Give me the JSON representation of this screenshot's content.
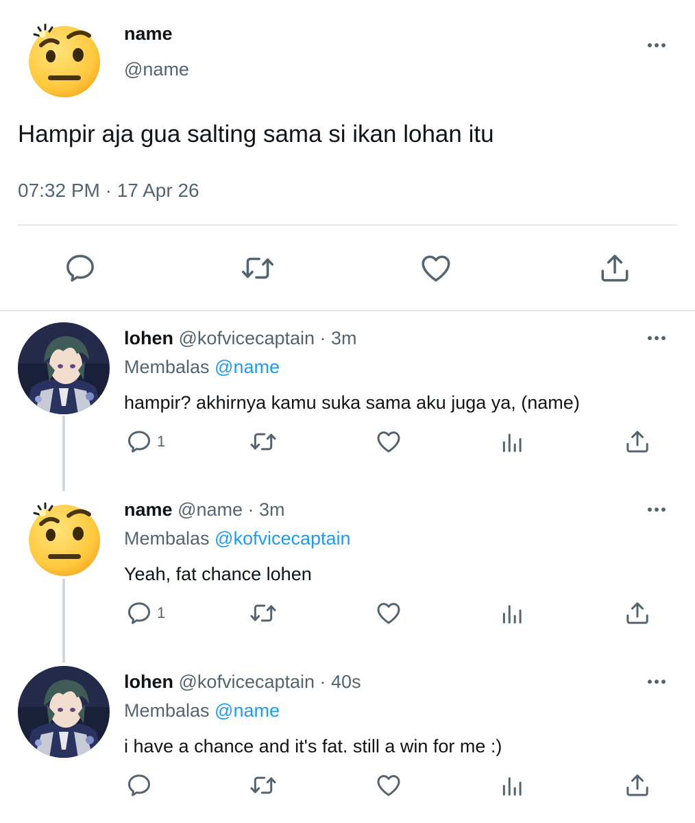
{
  "main_tweet": {
    "author_name": "name",
    "author_handle": "@name",
    "text": "Hampir aja gua salting sama si ikan lohan itu",
    "timestamp": "07:32 PM · 17 Apr 26",
    "avatar": "raised-eyebrow-emoji"
  },
  "replies": [
    {
      "author_name": "lohen",
      "author_handle": "@kofvicecaptain",
      "separator": " · ",
      "time": "3m",
      "reply_label": "Membalas ",
      "reply_to": "@name",
      "text": "hampir? akhirnya kamu suka sama aku juga ya, (name)",
      "reply_count": "1",
      "avatar": "anime-character-avatar"
    },
    {
      "author_name": "name",
      "author_handle": "@name",
      "separator": " · ",
      "time": "3m",
      "reply_label": "Membalas ",
      "reply_to": "@kofvicecaptain",
      "text": "Yeah, fat chance lohen",
      "reply_count": "1",
      "avatar": "raised-eyebrow-emoji"
    },
    {
      "author_name": "lohen",
      "author_handle": "@kofvicecaptain",
      "separator": " · ",
      "time": "40s",
      "reply_label": "Membalas ",
      "reply_to": "@name",
      "text": "i have a chance and it's fat. still a win for me :)",
      "reply_count": "",
      "avatar": "anime-character-avatar"
    }
  ],
  "icons": {
    "reply": "reply-icon",
    "retweet": "retweet-icon",
    "like": "like-icon",
    "views": "views-icon",
    "share": "share-icon",
    "more": "more-icon"
  },
  "colors": {
    "text": "#0f1419",
    "secondary": "#536471",
    "mention": "#1d9bf0",
    "divider": "#e6e9ec",
    "emoji_face": "#ffc83d"
  }
}
